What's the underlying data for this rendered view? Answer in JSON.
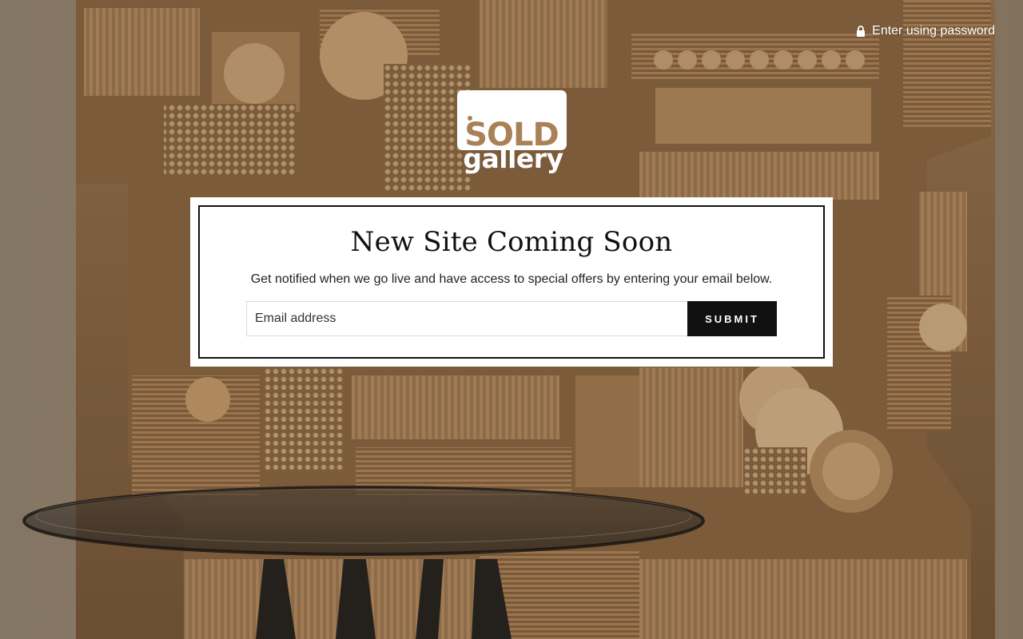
{
  "header": {
    "password_link_label": "Enter using password",
    "lock_icon": "lock-icon"
  },
  "logo": {
    "alt": "Sold Gallery",
    "word_top": "SOLD",
    "word_bottom": "gallery"
  },
  "newsletter": {
    "title": "New Site Coming Soon",
    "subtitle": "Get notified when we go live and have access to special offers by entering your email below.",
    "email_placeholder": "Email address",
    "email_value": "",
    "submit_label": "Submit"
  },
  "colors": {
    "card_background": "#ffffff",
    "card_border": "#111111",
    "button_background": "#111111",
    "button_text": "#ffffff",
    "link_text": "#ffffff"
  }
}
